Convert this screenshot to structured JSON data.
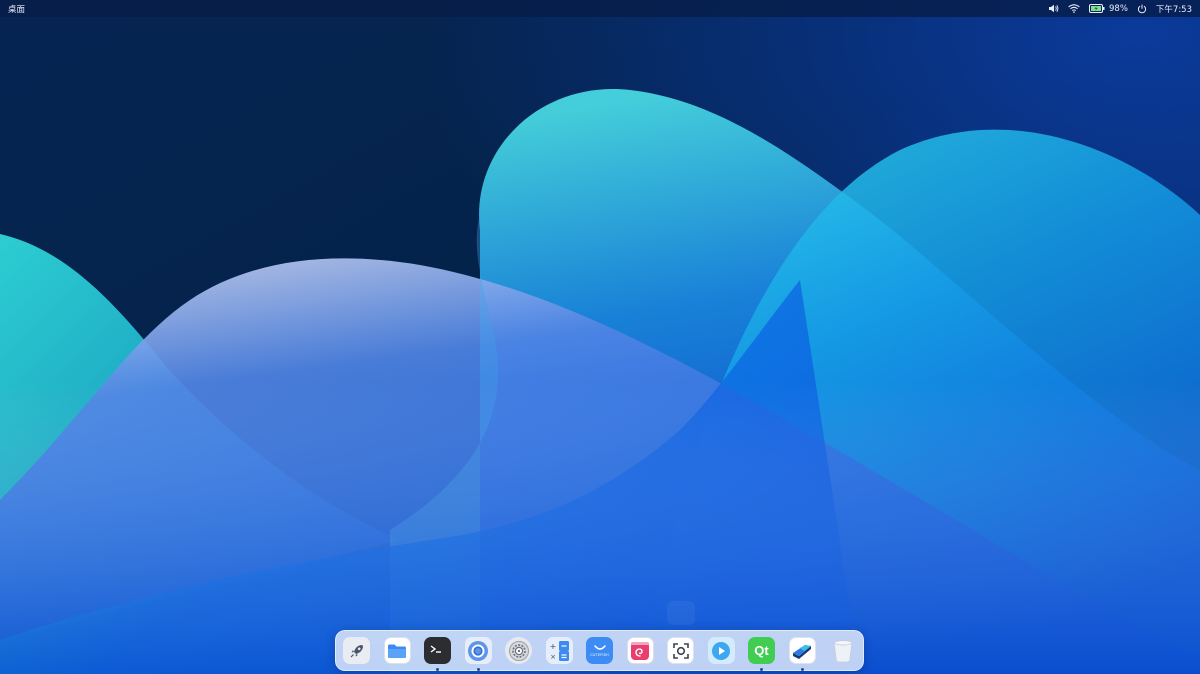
{
  "topbar": {
    "active_app_title": "桌面",
    "volume_icon": "volume-icon",
    "wifi_icon": "wifi-icon",
    "battery_icon": "battery-icon",
    "battery_percent": "98%",
    "power_icon": "power-icon",
    "clock": "下午7:53"
  },
  "dock": {
    "items": [
      {
        "name": "launcher",
        "icon": "rocket-icon",
        "running": false
      },
      {
        "name": "file-manager",
        "icon": "folder-icon",
        "running": false
      },
      {
        "name": "terminal",
        "icon": "terminal-icon",
        "running": true
      },
      {
        "name": "browser",
        "icon": "chromium-icon",
        "running": true
      },
      {
        "name": "settings",
        "icon": "gear-icon",
        "running": false
      },
      {
        "name": "calculator",
        "icon": "calculator-icon",
        "running": false
      },
      {
        "name": "cutefish-store",
        "icon": "cutefish-icon",
        "label": "CUTEFISH",
        "running": false
      },
      {
        "name": "debian-app",
        "icon": "debian-swirl-icon",
        "running": false
      },
      {
        "name": "screenshot",
        "icon": "screenshot-icon",
        "running": false
      },
      {
        "name": "video-player",
        "icon": "play-icon",
        "running": false
      },
      {
        "name": "qt-creator",
        "icon": "qt-icon",
        "label": "Qt",
        "running": true
      },
      {
        "name": "installer",
        "icon": "installer-icon",
        "running": true
      },
      {
        "name": "trash",
        "icon": "trash-icon",
        "running": false
      }
    ]
  },
  "colors": {
    "wallpaper_dark": "#03204a",
    "wallpaper_blue": "#0a5fe0",
    "wallpaper_cyan": "#2ad4e6",
    "topbar_bg": "#061c46",
    "dock_bg": "#ebf1fc"
  }
}
